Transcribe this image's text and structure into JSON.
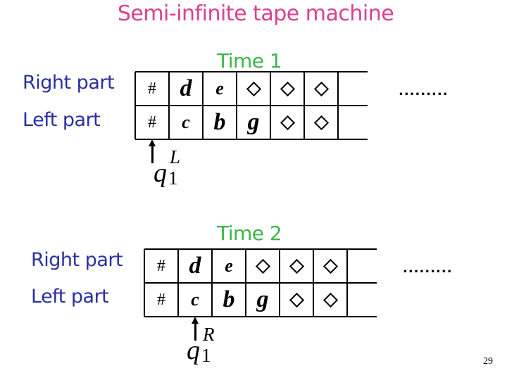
{
  "title": "Semi-infinite tape machine",
  "snapshots": [
    {
      "time_label": "Time 1",
      "right_label": "Right part",
      "left_label": "Left part",
      "right_cells": [
        "#",
        "d",
        "e",
        "◇",
        "◇",
        "◇",
        ""
      ],
      "left_cells": [
        "#",
        "c",
        "b",
        "g",
        "◇",
        "◇",
        ""
      ],
      "ellipsis": ".........",
      "head_row": "left",
      "head_cell_index": 0,
      "state": {
        "symbol": "q",
        "subscript": "1",
        "superscript": "L"
      }
    },
    {
      "time_label": "Time 2",
      "right_label": "Right part",
      "left_label": "Left part",
      "right_cells": [
        "#",
        "d",
        "e",
        "◇",
        "◇",
        "◇",
        ""
      ],
      "left_cells": [
        "#",
        "c",
        "b",
        "g",
        "◇",
        "◇",
        ""
      ],
      "ellipsis": ".........",
      "head_row": "left",
      "head_cell_index": 1,
      "state": {
        "symbol": "q",
        "subscript": "1",
        "superscript": "R"
      }
    }
  ],
  "page_number": "29",
  "colors": {
    "title": "#d9408e",
    "time_label": "#3cb64a",
    "row_label": "#2b2fa0"
  }
}
